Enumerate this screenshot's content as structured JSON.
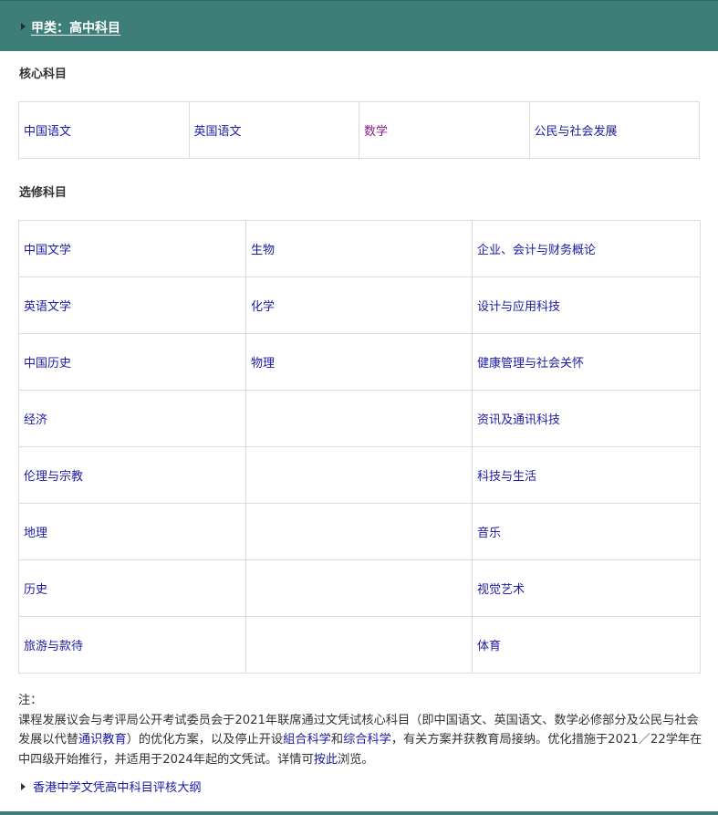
{
  "header": {
    "title": "甲类：高中科目"
  },
  "core": {
    "label": "核心科目",
    "subjects": [
      "中国语文",
      "英国语文",
      "数学",
      "公民与社会发展"
    ]
  },
  "elective": {
    "label": "选修科目",
    "rows": [
      [
        "中国文学",
        "生物",
        "企业、会计与财务概论"
      ],
      [
        "英语文学",
        "化学",
        "设计与应用科技"
      ],
      [
        "中国历史",
        "物理",
        "健康管理与社会关怀"
      ],
      [
        "经济",
        "",
        "资讯及通讯科技"
      ],
      [
        "伦理与宗教",
        "",
        "科技与生活"
      ],
      [
        "地理",
        "",
        "音乐"
      ],
      [
        "历史",
        "",
        "视觉艺术"
      ],
      [
        "旅游与款待",
        "",
        "体育"
      ]
    ]
  },
  "note": {
    "heading": "注：",
    "text_1": "课程发展议会与考评局公开考试委员会于2021年联席通过文凭试核心科目（即中国语文、英国语文、数学必修部分及公民与社会发展以代替",
    "link_1": "通识教育",
    "text_2": "）的优化方案，以及停止开设",
    "link_2": "組合科学",
    "text_3": "和",
    "link_3": "综合科学",
    "text_4": "，有关方案并获教育局接纳。优化措施于2021／22学年在中四级开始推行，并适用于2024年起的文凭试。详情可",
    "link_4": "按此",
    "text_5": "浏览。"
  },
  "footer_link": "香港中学文凭高中科目评核大纲"
}
